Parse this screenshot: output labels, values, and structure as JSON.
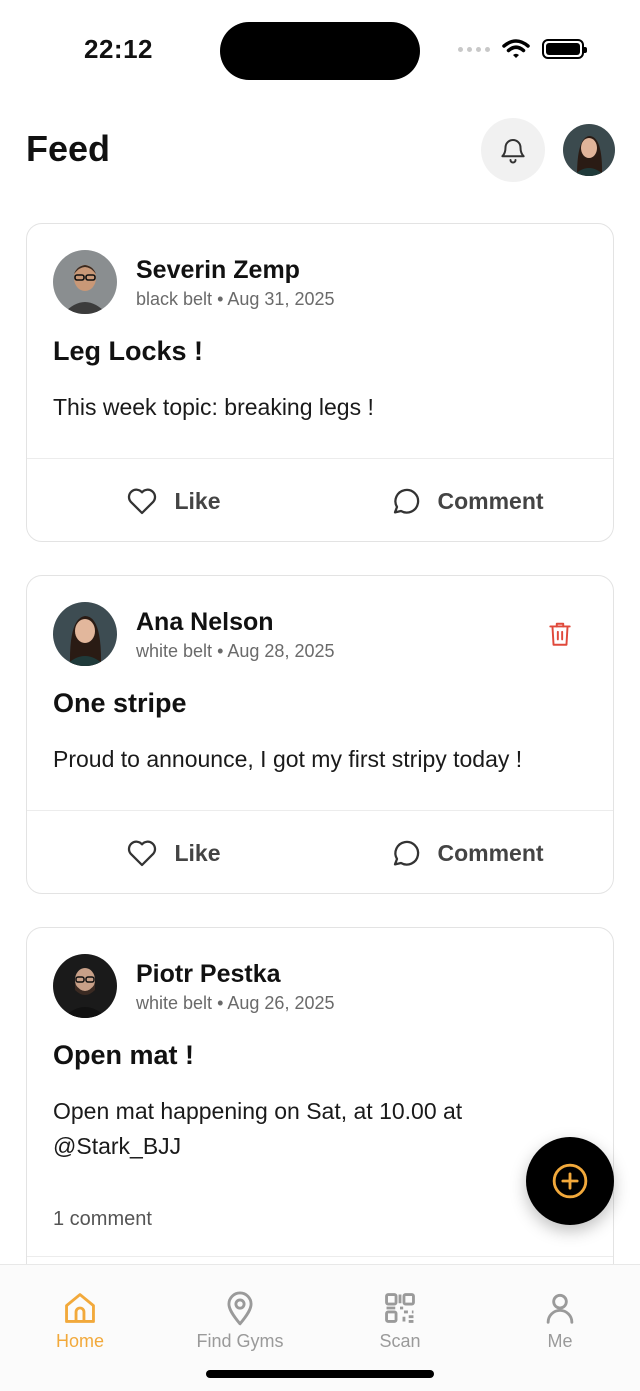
{
  "status_bar": {
    "time": "22:12"
  },
  "header": {
    "title": "Feed"
  },
  "posts": [
    {
      "author": "Severin Zemp",
      "belt": "black belt",
      "date": "Aug 31, 2025",
      "title": "Leg Locks !",
      "body": "This week topic: breaking legs !",
      "like_label": "Like",
      "comment_label": "Comment"
    },
    {
      "author": "Ana Nelson",
      "belt": "white belt",
      "date": "Aug 28, 2025",
      "title": "One stripe",
      "body": "Proud to announce, I got my first stripy today !",
      "like_label": "Like",
      "comment_label": "Comment"
    },
    {
      "author": "Piotr Pestka",
      "belt": "white belt",
      "date": "Aug 26, 2025",
      "title": "Open mat !",
      "body": "Open mat happening on Sat, at 10.00 at @Stark_BJJ",
      "comment_count": "1 comment"
    }
  ],
  "meta_separator": "•",
  "tabs": [
    {
      "label": "Home",
      "icon": "home-icon",
      "active": true
    },
    {
      "label": "Find Gyms",
      "icon": "map-pin-icon",
      "active": false
    },
    {
      "label": "Scan",
      "icon": "qr-code-icon",
      "active": false
    },
    {
      "label": "Me",
      "icon": "person-icon",
      "active": false
    }
  ],
  "colors": {
    "accent": "#f2a93b",
    "delete": "#e0493b",
    "text_secondary": "#6a6a6a"
  }
}
